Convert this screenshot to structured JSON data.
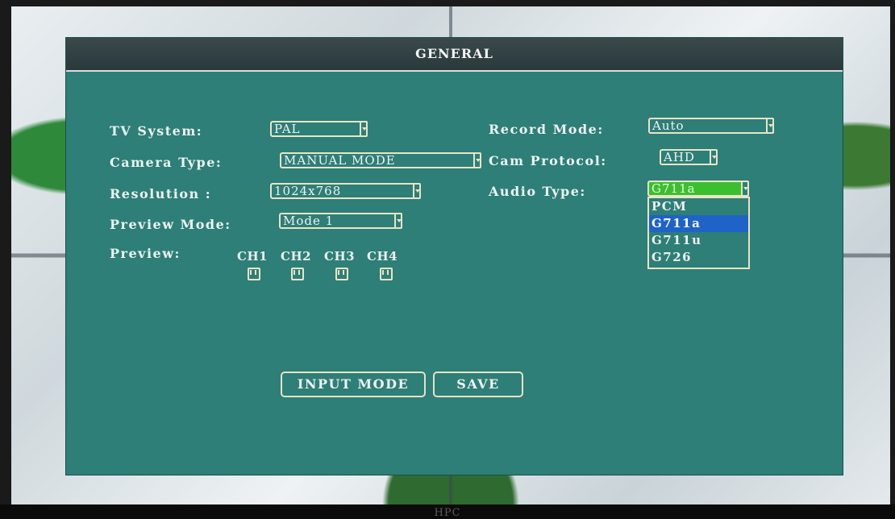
{
  "window": {
    "title": "GENERAL"
  },
  "monitor": {
    "brand": "HPC"
  },
  "fields": {
    "tv_system": {
      "label": "TV  System:",
      "value": "PAL"
    },
    "camera_type": {
      "label": "Camera Type:",
      "value": "MANUAL MODE"
    },
    "resolution": {
      "label": "Resolution :",
      "value": "1024x768"
    },
    "preview_mode": {
      "label": "Preview Mode:",
      "value": "Mode 1"
    },
    "preview": {
      "label": "Preview:"
    },
    "record_mode": {
      "label": "Record Mode:",
      "value": "Auto"
    },
    "cam_protocol": {
      "label": "Cam Protocol:",
      "value": "AHD"
    },
    "audio_type": {
      "label": "Audio  Type:",
      "value": "G711a",
      "options": [
        "PCM",
        "G711a",
        "G711u",
        "G726"
      ],
      "highlighted": "G711a"
    }
  },
  "channels": [
    {
      "label": "CH1",
      "checked": true
    },
    {
      "label": "CH2",
      "checked": true
    },
    {
      "label": "CH3",
      "checked": true
    },
    {
      "label": "CH4",
      "checked": true
    }
  ],
  "buttons": {
    "input_mode": "INPUT MODE",
    "save": "SAVE"
  },
  "colors": {
    "panel": "#2d7f77",
    "border": "#eae4c6",
    "selected_field": "#3bbf2f",
    "highlight": "#1f63c8"
  }
}
